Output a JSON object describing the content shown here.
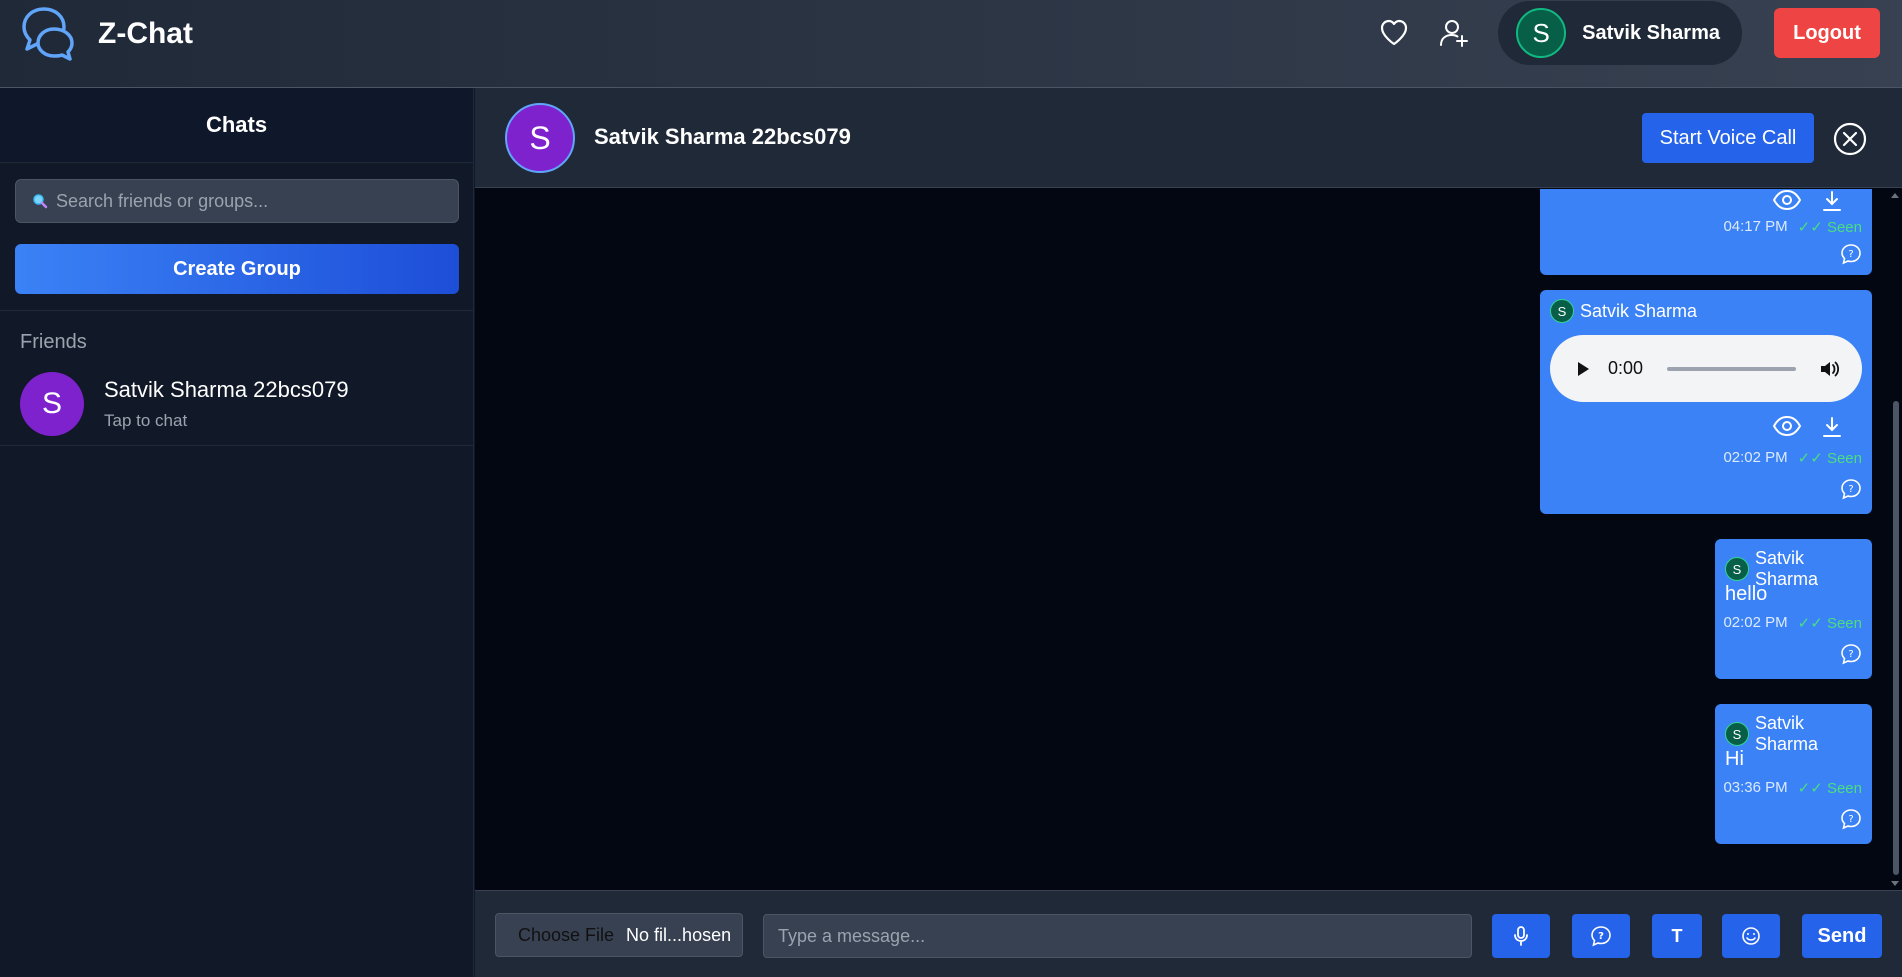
{
  "app": {
    "name": "Z-Chat"
  },
  "nav": {
    "user_name": "Satvik Sharma",
    "user_initial": "S",
    "logout_label": "Logout"
  },
  "sidebar": {
    "title": "Chats",
    "search_placeholder": "Search friends or groups...",
    "create_group_label": "Create Group",
    "friends_label": "Friends",
    "friends": [
      {
        "initial": "S",
        "name": "Satvik Sharma 22bcs079",
        "subtitle": "Tap to chat"
      }
    ]
  },
  "chat": {
    "contact_initial": "S",
    "contact_name": "Satvik Sharma 22bcs079",
    "voice_call_label": "Start Voice Call",
    "messages": [
      {
        "type": "file",
        "time": "04:17 PM",
        "status": "✓✓ Seen"
      },
      {
        "type": "audio",
        "sender": "Satvik Sharma",
        "sender_initial": "S",
        "audio_time": "0:00",
        "time": "02:02 PM",
        "status": "✓✓ Seen"
      },
      {
        "type": "text",
        "sender": "Satvik Sharma",
        "sender_initial": "S",
        "text": "hello",
        "time": "02:02 PM",
        "status": "✓✓ Seen"
      },
      {
        "type": "text",
        "sender": "Satvik Sharma",
        "sender_initial": "S",
        "text": "Hi",
        "time": "03:36 PM",
        "status": "✓✓ Seen"
      }
    ]
  },
  "composer": {
    "choose_file_label": "Choose File",
    "file_status": "No fil...hosen",
    "message_placeholder": "Type a message...",
    "text_tool_label": "T",
    "send_label": "Send"
  },
  "colors": {
    "accent": "#3b82f6",
    "button_blue": "#2563eb",
    "danger": "#ef4444",
    "seen": "#4ade80",
    "avatar_purple": "#7e22ce"
  }
}
